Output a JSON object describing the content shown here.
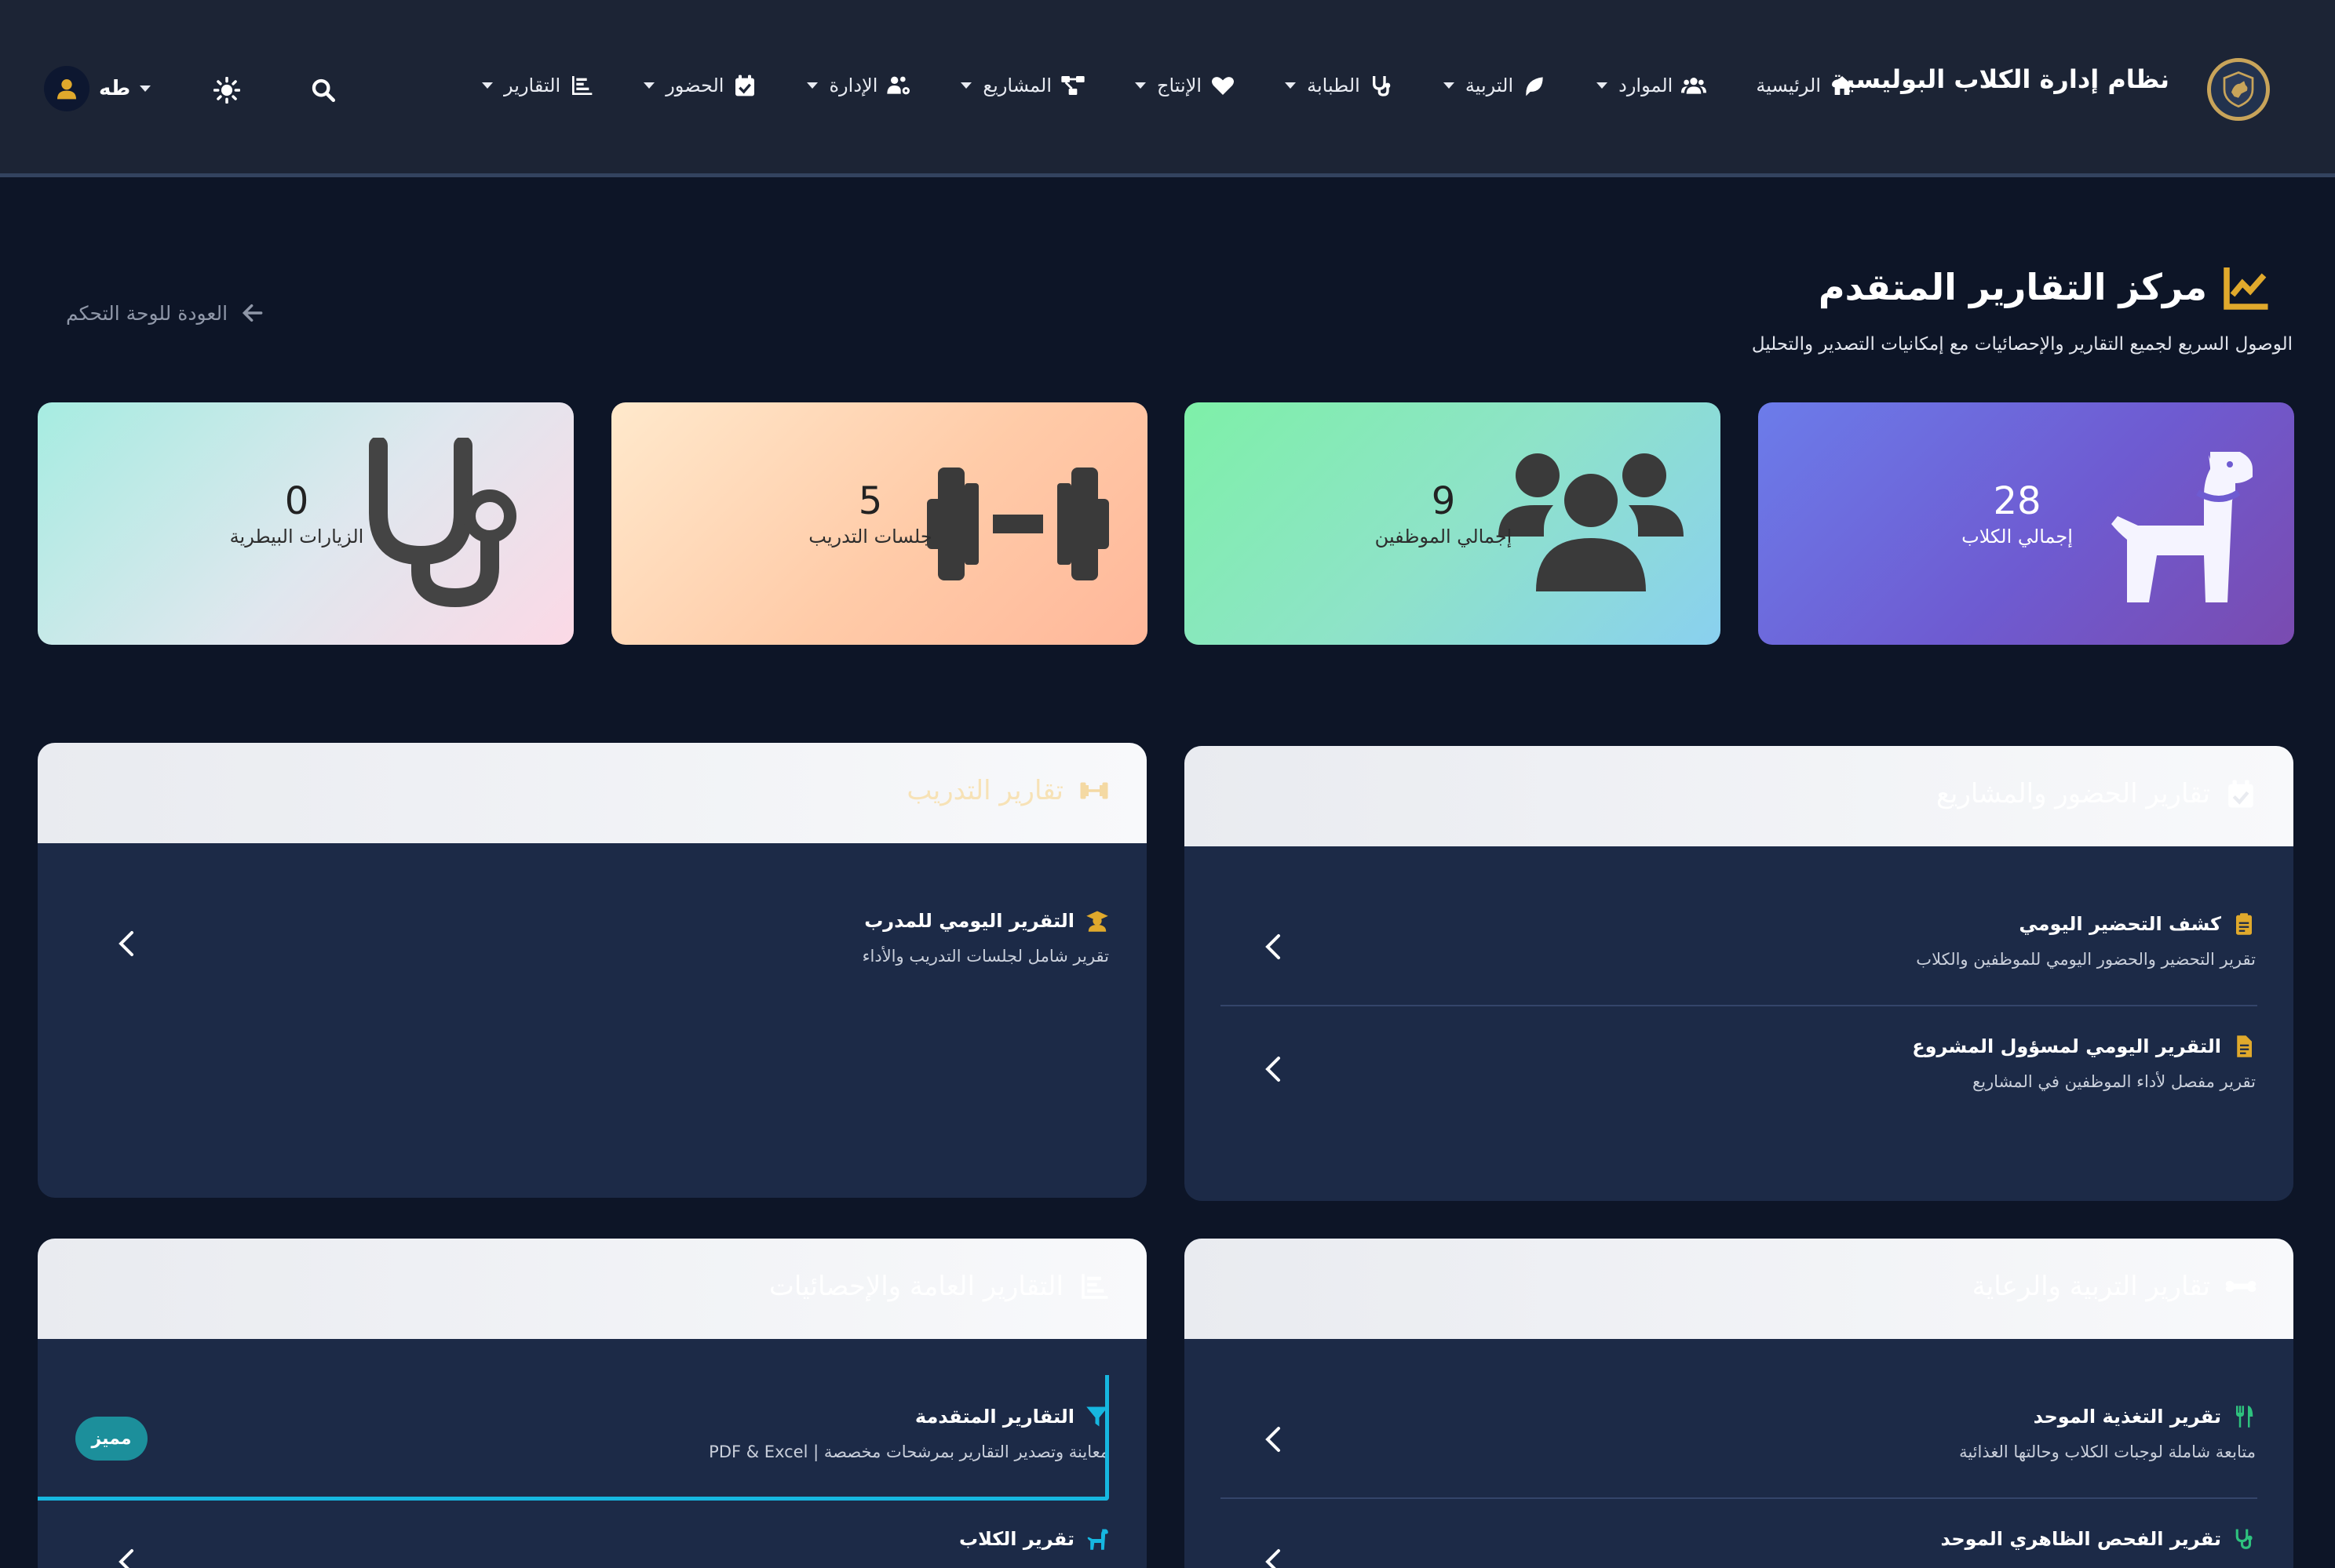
{
  "nav": {
    "brand": "نظام إدارة الكلاب البوليسية",
    "items": [
      {
        "label": "الرئيسية",
        "icon": "home-icon"
      },
      {
        "label": "الموارد",
        "icon": "users-icon"
      },
      {
        "label": "التربية",
        "icon": "leaf-icon"
      },
      {
        "label": "الطبابة",
        "icon": "stethoscope-icon"
      },
      {
        "label": "الإنتاج",
        "icon": "heart-icon"
      },
      {
        "label": "المشاريع",
        "icon": "project-diagram-icon"
      },
      {
        "label": "الإدارة",
        "icon": "users-cog-icon"
      },
      {
        "label": "الحضور",
        "icon": "calendar-check-icon"
      },
      {
        "label": "التقارير",
        "icon": "chart-bar-icon"
      }
    ],
    "user_name": "طه"
  },
  "header": {
    "title": "مركز التقارير المتقدم",
    "subtitle": "الوصول السريع لجميع التقارير والإحصائيات مع إمكانيات التصدير والتحليل",
    "back_label": "العودة للوحة التحكم"
  },
  "stats": {
    "dogs": {
      "value": "28",
      "label": "إجمالي الكلاب"
    },
    "staff": {
      "value": "9",
      "label": "إجمالي الموظفين"
    },
    "training": {
      "value": "5",
      "label": "جلسات التدريب"
    },
    "vet": {
      "value": "0",
      "label": "الزيارات البيطرية"
    }
  },
  "panels": {
    "attendance": {
      "title": "تقارير الحضور والمشاريع",
      "items": [
        {
          "title": "كشف التحضير اليومي",
          "desc": "تقرير التحضير والحضور اليومي للموظفين والكلاب"
        },
        {
          "title": "التقرير اليومي لمسؤول المشروع",
          "desc": "تقرير مفصل لأداء الموظفين في المشاريع"
        }
      ]
    },
    "training": {
      "title": "تقارير التدريب",
      "items": [
        {
          "title": "التقرير اليومي للمدرب",
          "desc": "تقرير شامل لجلسات التدريب والأداء"
        }
      ]
    },
    "breeding": {
      "title": "تقارير التربية والرعاية",
      "items": [
        {
          "title": "تقرير التغذية الموحد",
          "desc": "متابعة شاملة لوجبات الكلاب وحالتها الغذائية"
        },
        {
          "title": "تقرير الفحص الظاهري الموحد",
          "desc": ""
        }
      ]
    },
    "general": {
      "title": "التقارير العامة والإحصائيات",
      "items": [
        {
          "title": "التقارير المتقدمة",
          "desc": "معاينة وتصدير التقارير بمرشحات مخصصة | PDF & Excel",
          "badge": "مميز"
        },
        {
          "title": "تقرير الكلاب",
          "desc": ""
        }
      ]
    }
  },
  "colors": {
    "gold_accent": "#e0a92c",
    "cyan_accent": "#16b7e0",
    "green_accent": "#2ec27e",
    "navbar_bg": "#1c2435",
    "page_bg": "#0d1527",
    "panel_bg": "#1c2a47"
  }
}
